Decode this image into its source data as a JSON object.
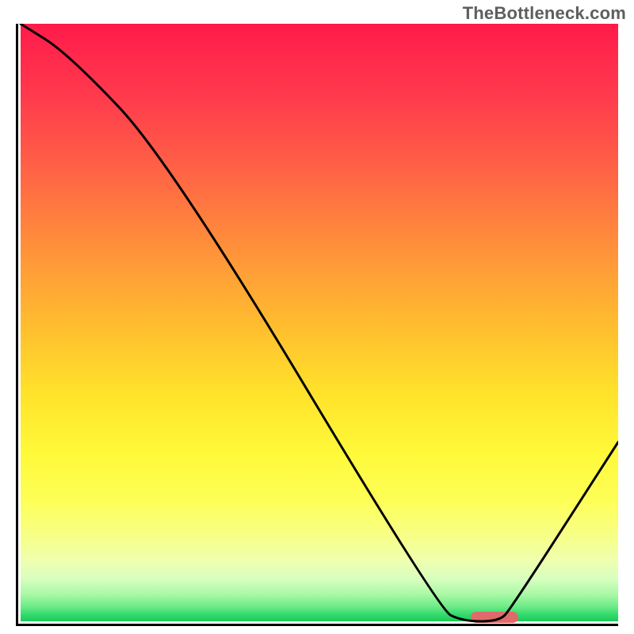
{
  "watermark": "TheBottleneck.com",
  "chart_data": {
    "type": "line",
    "title": "",
    "xlabel": "",
    "ylabel": "",
    "xlim": [
      0,
      100
    ],
    "ylim": [
      0,
      100
    ],
    "series": [
      {
        "name": "bottleneck-curve",
        "x": [
          0,
          8,
          25,
          70,
          74,
          80,
          82,
          100
        ],
        "values": [
          100,
          95,
          77,
          2,
          0,
          0,
          2,
          30
        ]
      }
    ],
    "marker": {
      "name": "optimal-range",
      "x_start": 75,
      "x_end": 83,
      "y": 1
    },
    "gradient_stops": [
      {
        "pct": 0,
        "color": "#ff1b4a"
      },
      {
        "pct": 50,
        "color": "#ffc22e"
      },
      {
        "pct": 80,
        "color": "#fdff58"
      },
      {
        "pct": 100,
        "color": "#1cc85a"
      }
    ]
  }
}
